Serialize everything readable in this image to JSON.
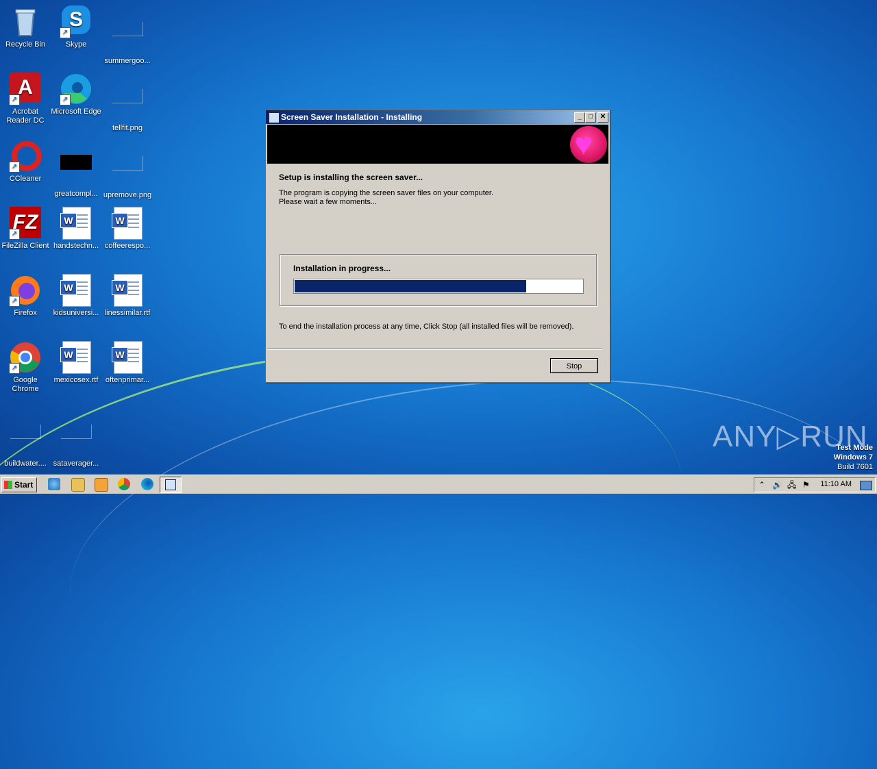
{
  "desktop": {
    "icons": [
      {
        "label": "Recycle Bin"
      },
      {
        "label": "Skype"
      },
      {
        "label": "summergoo..."
      },
      {
        "label": "Acrobat Reader DC"
      },
      {
        "label": "Microsoft Edge"
      },
      {
        "label": "tellfit.png"
      },
      {
        "label": "CCleaner"
      },
      {
        "label": "greatcompl..."
      },
      {
        "label": "upremove.png"
      },
      {
        "label": "FileZilla Client"
      },
      {
        "label": "handstechn..."
      },
      {
        "label": "coffeerespo..."
      },
      {
        "label": "Firefox"
      },
      {
        "label": "kidsuniversi..."
      },
      {
        "label": "linessimilar.rtf"
      },
      {
        "label": "Google Chrome"
      },
      {
        "label": "mexicosex.rtf"
      },
      {
        "label": "oftenprimar..."
      },
      {
        "label": "buildwater...."
      },
      {
        "label": "sataverager..."
      }
    ]
  },
  "dialog": {
    "title": "Screen Saver Installation - Installing",
    "heading": "Setup is installing the screen saver...",
    "text_line1": "The program is copying the screen saver files on your computer.",
    "text_line2": "Please wait a few moments...",
    "group_label": "Installation in progress...",
    "progress_percent": 80,
    "end_text": "To end the installation process at any time, Click Stop (all installed files will be removed).",
    "stop_label": "Stop",
    "min_glyph": "_",
    "max_glyph": "□",
    "close_glyph": "✕",
    "heart_glyph": "♥"
  },
  "watermark": "ANY▷RUN",
  "test_mode": {
    "line1": "Test Mode",
    "line2": "Windows 7",
    "line3": "Build 7601"
  },
  "taskbar": {
    "start_label": "Start",
    "clock": "11:10 AM",
    "tray_glyphs": [
      "⌃",
      "🔊",
      "🖧",
      "⚑"
    ]
  },
  "colors": {
    "progress_fill": "#0a246a",
    "title_bar": "#0a246a",
    "dialog_bg": "#d4d0c8"
  }
}
